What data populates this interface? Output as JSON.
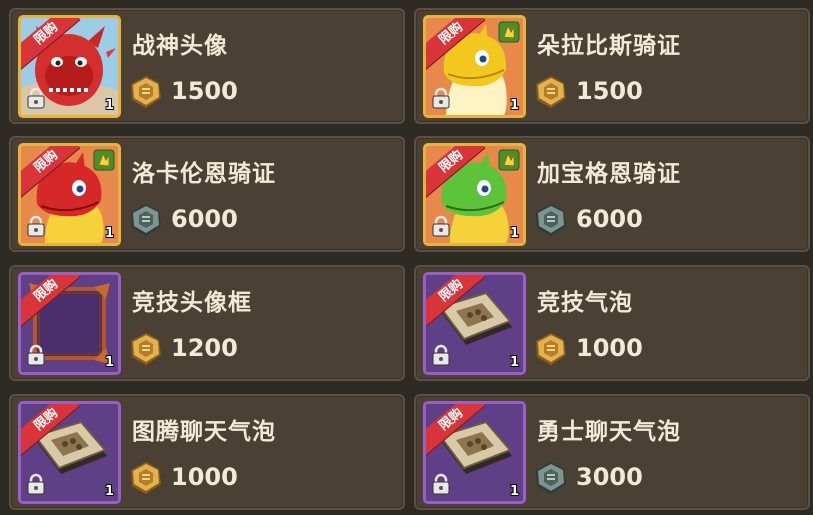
{
  "ribbon_text": "限购",
  "colors": {
    "card_bg": "#4a4134",
    "gold_frame": "#e9b23c",
    "purple_frame": "#9a5fc6",
    "ribbon": "#d8343a",
    "gold_coin": "#e3b24a",
    "silver_coin": "#6f8a86"
  },
  "items": [
    {
      "name": "战神头像",
      "price": "1500",
      "currency": "gold-coin",
      "quantity": "1",
      "art": "red-dragon-helmet"
    },
    {
      "name": "朵拉比斯骑证",
      "price": "1500",
      "currency": "gold-coin",
      "quantity": "1",
      "art": "yellow-dragon"
    },
    {
      "name": "洛卡伦恩骑证",
      "price": "6000",
      "currency": "silver-coin",
      "quantity": "1",
      "art": "red-yellow-dragon"
    },
    {
      "name": "加宝格恩骑证",
      "price": "6000",
      "currency": "silver-coin",
      "quantity": "1",
      "art": "green-yellow-dragon"
    },
    {
      "name": "竞技头像框",
      "price": "1200",
      "currency": "gold-coin",
      "quantity": "1",
      "art": "avatar-frame"
    },
    {
      "name": "竞技气泡",
      "price": "1000",
      "currency": "gold-coin",
      "quantity": "1",
      "art": "chat-bubble-plaque"
    },
    {
      "name": "图腾聊天气泡",
      "price": "1000",
      "currency": "gold-coin",
      "quantity": "1",
      "art": "chat-bubble-plaque"
    },
    {
      "name": "勇士聊天气泡",
      "price": "3000",
      "currency": "silver-coin",
      "quantity": "1",
      "art": "chat-bubble-plaque"
    }
  ]
}
